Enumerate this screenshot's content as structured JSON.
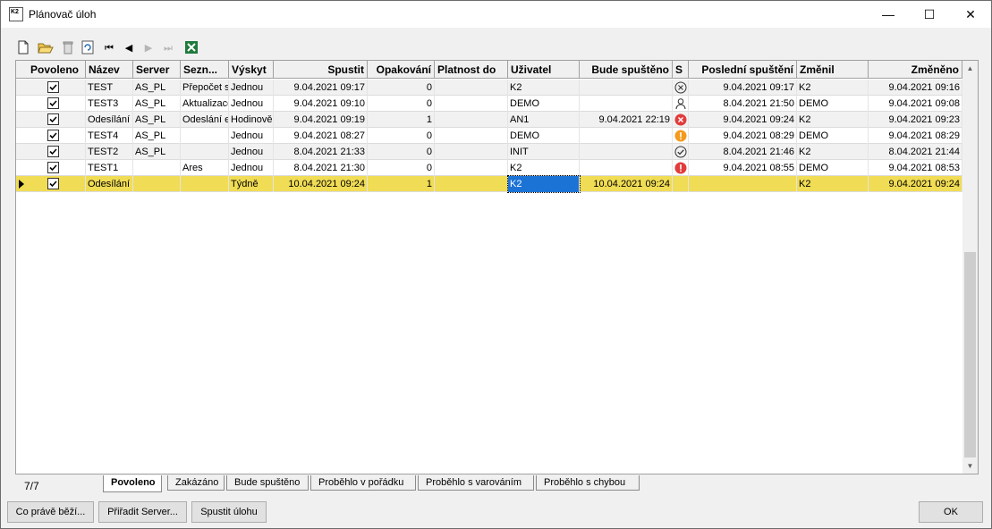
{
  "window": {
    "title": "Plánovač úloh",
    "app_icon_text": "K2",
    "min": "—",
    "max": "☐",
    "close": "✕"
  },
  "columns": [
    "Povoleno",
    "Název",
    "Server",
    "Sezn...",
    "Výskyt",
    "Spustit",
    "Opakování",
    "Platnost do",
    "Uživatel",
    "Bude spuštěno",
    "S",
    "Poslední spuštění",
    "Změnil",
    "Změněno"
  ],
  "rows": [
    {
      "nazev": "TEST",
      "server": "AS_PL",
      "sezn": "Přepočet s",
      "vyskyt": "Jednou",
      "spustit": "9.04.2021 09:17",
      "opak": "0",
      "platnost": "",
      "uzivatel": "K2",
      "bude": "",
      "s_icon": "cancelled-icon",
      "posledni": "9.04.2021 09:17",
      "zmenil": "K2",
      "zmeneno": "9.04.2021 09:16"
    },
    {
      "nazev": "TEST3",
      "server": "AS_PL",
      "sezn": "Aktualizace",
      "vyskyt": "Jednou",
      "spustit": "9.04.2021 09:10",
      "opak": "0",
      "platnost": "",
      "uzivatel": "DEMO",
      "bude": "",
      "s_icon": "user-icon",
      "posledni": "8.04.2021 21:50",
      "zmenil": "DEMO",
      "zmeneno": "9.04.2021 09:08"
    },
    {
      "nazev": "Odesílání s",
      "server": "AS_PL",
      "sezn": "Odeslání e",
      "vyskyt": "Hodinově",
      "spustit": "9.04.2021 09:19",
      "opak": "1",
      "platnost": "",
      "uzivatel": "AN1",
      "bude": "9.04.2021 22:19",
      "s_icon": "error-icon",
      "posledni": "9.04.2021 09:24",
      "zmenil": "K2",
      "zmeneno": "9.04.2021 09:23"
    },
    {
      "nazev": "TEST4",
      "server": "AS_PL",
      "sezn": "",
      "vyskyt": "Jednou",
      "spustit": "9.04.2021 08:27",
      "opak": "0",
      "platnost": "",
      "uzivatel": "DEMO",
      "bude": "",
      "s_icon": "warning-icon",
      "posledni": "9.04.2021 08:29",
      "zmenil": "DEMO",
      "zmeneno": "9.04.2021 08:29"
    },
    {
      "nazev": "TEST2",
      "server": "AS_PL",
      "sezn": "",
      "vyskyt": "Jednou",
      "spustit": "8.04.2021 21:33",
      "opak": "0",
      "platnost": "",
      "uzivatel": "INIT",
      "bude": "",
      "s_icon": "ok-icon",
      "posledni": "8.04.2021 21:46",
      "zmenil": "K2",
      "zmeneno": "8.04.2021 21:44"
    },
    {
      "nazev": "TEST1",
      "server": "",
      "sezn": "Ares",
      "vyskyt": "Jednou",
      "spustit": "8.04.2021 21:30",
      "opak": "0",
      "platnost": "",
      "uzivatel": "K2",
      "bude": "",
      "s_icon": "alert-icon",
      "posledni": "9.04.2021 08:55",
      "zmenil": "DEMO",
      "zmeneno": "9.04.2021 08:53"
    },
    {
      "nazev": "Odesílání s",
      "server": "",
      "sezn": "",
      "vyskyt": "Týdně",
      "spustit": "10.04.2021 09:24",
      "opak": "1",
      "platnost": "",
      "uzivatel": "K2",
      "bude": "10.04.2021 09:24",
      "s_icon": "",
      "posledni": "",
      "zmenil": "K2",
      "zmeneno": "9.04.2021 09:24"
    }
  ],
  "status": {
    "count": "7/7"
  },
  "tabs": [
    "Povoleno",
    "Zakázáno",
    "Bude spuštěno",
    "Proběhlo v pořádku",
    "Proběhlo s varováním",
    "Proběhlo s chybou"
  ],
  "buttons": {
    "running": "Co právě běží...",
    "assign": "Přiřadit Server...",
    "run": "Spustit úlohu",
    "ok": "OK"
  },
  "colors": {
    "selected_row": "#f0dc55",
    "focus_cell": "#1c73d6",
    "error": "#e23b3b",
    "warning": "#f59a1c"
  }
}
